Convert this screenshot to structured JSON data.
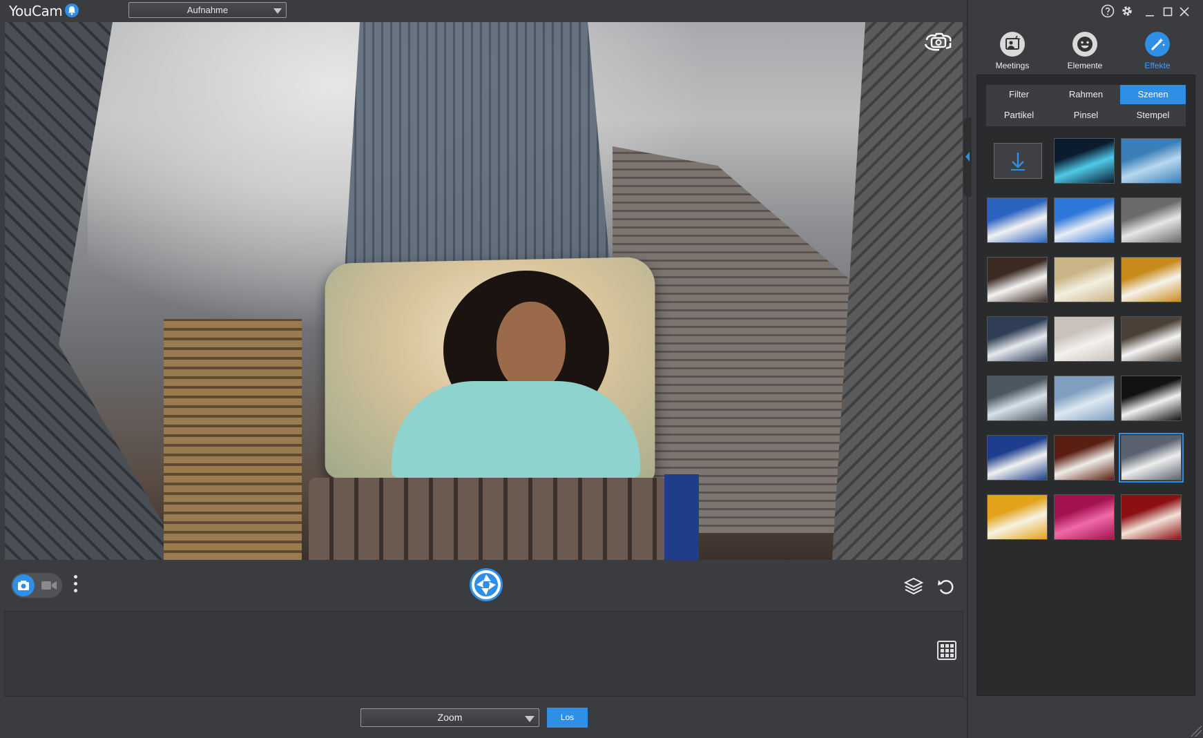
{
  "app": {
    "title": "YouCam"
  },
  "header": {
    "mode_select_value": "Aufnahme"
  },
  "window_controls": [
    "help",
    "settings",
    "minimize",
    "maximize",
    "close"
  ],
  "colors": {
    "accent": "#2f8fe6",
    "background": "#3b3c3f",
    "panel": "#2a2b2d"
  },
  "panel": {
    "tabs": [
      {
        "label": "Meetings",
        "icon": "meetings-icon",
        "active": false
      },
      {
        "label": "Elemente",
        "icon": "smiley-icon",
        "active": false
      },
      {
        "label": "Effekte",
        "icon": "magic-wand-icon",
        "active": true
      }
    ],
    "subtabs": [
      {
        "label": "Filter",
        "active": false
      },
      {
        "label": "Rahmen",
        "active": false
      },
      {
        "label": "Szenen",
        "active": true
      },
      {
        "label": "Partikel",
        "active": false
      },
      {
        "label": "Pinsel",
        "active": false
      },
      {
        "label": "Stempel",
        "active": false
      }
    ],
    "scenes": [
      {
        "name": "download",
        "kind": "download"
      },
      {
        "name": "spotlight-stage",
        "kind": "scene",
        "c1": "#0b1c2e",
        "c2": "#4fc9e8"
      },
      {
        "name": "blue-frame",
        "kind": "scene",
        "c1": "#3a7fb8",
        "c2": "#b8d8ee"
      },
      {
        "name": "balloon-sign",
        "kind": "scene",
        "c1": "#2a64c0",
        "c2": "#f2f2f2"
      },
      {
        "name": "hot-air-balloon",
        "kind": "scene",
        "c1": "#2d78d8",
        "c2": "#e9eef5"
      },
      {
        "name": "gate-screen",
        "kind": "scene",
        "c1": "#6b6b6b",
        "c2": "#e6e6e6"
      },
      {
        "name": "tablet-hands",
        "kind": "scene",
        "c1": "#3a2a22",
        "c2": "#f4f4f4"
      },
      {
        "name": "gallery-frame",
        "kind": "scene",
        "c1": "#c9b487",
        "c2": "#f4efe2"
      },
      {
        "name": "autumn-easel",
        "kind": "scene",
        "c1": "#c88a1a",
        "c2": "#f6f3ec"
      },
      {
        "name": "train-station",
        "kind": "scene",
        "c1": "#2f3d55",
        "c2": "#e6e9ef"
      },
      {
        "name": "newspaper",
        "kind": "scene",
        "c1": "#c8c2bb",
        "c2": "#f3f1ee"
      },
      {
        "name": "city-billboard",
        "kind": "scene",
        "c1": "#4a4037",
        "c2": "#f5f5f5"
      },
      {
        "name": "window-cleaners",
        "kind": "scene",
        "c1": "#4d5762",
        "c2": "#d7e3ea"
      },
      {
        "name": "cloud-sky",
        "kind": "scene",
        "c1": "#7f9ec0",
        "c2": "#dde8f2"
      },
      {
        "name": "stadium-screens",
        "kind": "scene",
        "c1": "#121212",
        "c2": "#f0f0f0"
      },
      {
        "name": "street-billboard",
        "kind": "scene",
        "c1": "#1d3e8c",
        "c2": "#f1f1f1"
      },
      {
        "name": "theater-screen",
        "kind": "scene",
        "c1": "#5a1e12",
        "c2": "#f0ede8"
      },
      {
        "name": "times-square",
        "kind": "scene",
        "c1": "#5a6270",
        "c2": "#eeeeee",
        "selected": true
      },
      {
        "name": "birthday-cake",
        "kind": "scene",
        "c1": "#e2a21a",
        "c2": "#f7f2e3"
      },
      {
        "name": "pink-party",
        "kind": "scene",
        "c1": "#a3124f",
        "c2": "#f06aa8"
      },
      {
        "name": "red-love",
        "kind": "scene",
        "c1": "#8c0f12",
        "c2": "#f2e2d8"
      }
    ]
  },
  "footer": {
    "zoom_select_value": "Zoom",
    "go_label": "Los"
  }
}
